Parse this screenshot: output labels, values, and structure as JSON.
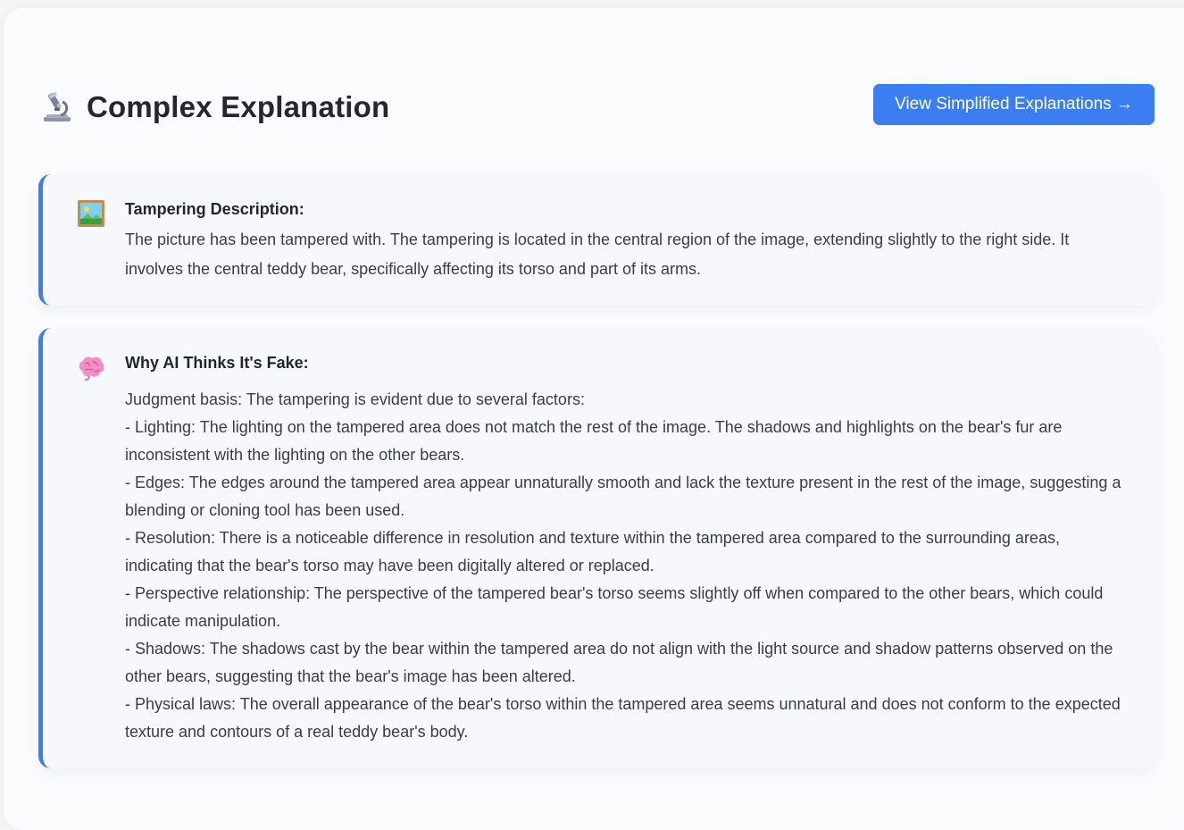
{
  "header": {
    "title": "Complex Explanation",
    "title_icon": "microscope-icon",
    "simplified_button_label": "View Simplified Explanations →"
  },
  "tampering": {
    "icon": "framed-picture-icon",
    "heading": "Tampering Description:",
    "text": "The picture has been tampered with. The tampering is located in the central region of the image, extending slightly to the right side. It involves the central teddy bear, specifically affecting its torso and part of its arms."
  },
  "why": {
    "icon": "brain-icon",
    "heading": "Why AI Thinks It's Fake:",
    "lines": [
      "Judgment basis: The tampering is evident due to several factors:",
      "- Lighting: The lighting on the tampered area does not match the rest of the image. The shadows and highlights on the bear's fur are inconsistent with the lighting on the other bears.",
      "- Edges: The edges around the tampered area appear unnaturally smooth and lack the texture present in the rest of the image, suggesting a blending or cloning tool has been used.",
      "- Resolution: There is a noticeable difference in resolution and texture within the tampered area compared to the surrounding areas, indicating that the bear's torso may have been digitally altered or replaced.",
      "- Perspective relationship: The perspective of the tampered bear's torso seems slightly off when compared to the other bears, which could indicate manipulation.",
      "- Shadows: The shadows cast by the bear within the tampered area do not align with the light source and shadow patterns observed on the other bears, suggesting that the bear's image has been altered.",
      "- Physical laws: The overall appearance of the bear's torso within the tampered area seems unnatural and does not conform to the expected texture and contours of a real teddy bear's body."
    ]
  },
  "colors": {
    "accent": "#3b7ef1",
    "card_background": "#f6f8fb",
    "page_background": "#f9fbfd"
  }
}
